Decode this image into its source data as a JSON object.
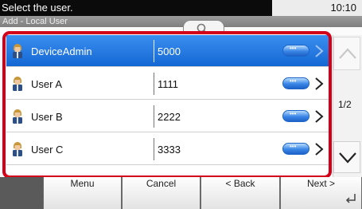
{
  "header": {
    "prompt": "Select the user.",
    "subtitle": "Add - Local User",
    "clock": "10:10",
    "search_icon": "search-icon"
  },
  "users": [
    {
      "name": "DeviceAdmin",
      "number": "5000",
      "selected": true
    },
    {
      "name": "User A",
      "number": "1111",
      "selected": false
    },
    {
      "name": "User B",
      "number": "2222",
      "selected": false
    },
    {
      "name": "User C",
      "number": "3333",
      "selected": false
    }
  ],
  "pagination": {
    "indicator": "1/2"
  },
  "buttons": {
    "menu": "Menu",
    "cancel": "Cancel",
    "back": "< Back",
    "next": "Next >"
  },
  "colors": {
    "selected_row": "#1e74e0",
    "highlight_frame": "#d4001a",
    "detail_button": "#3a86e6"
  }
}
